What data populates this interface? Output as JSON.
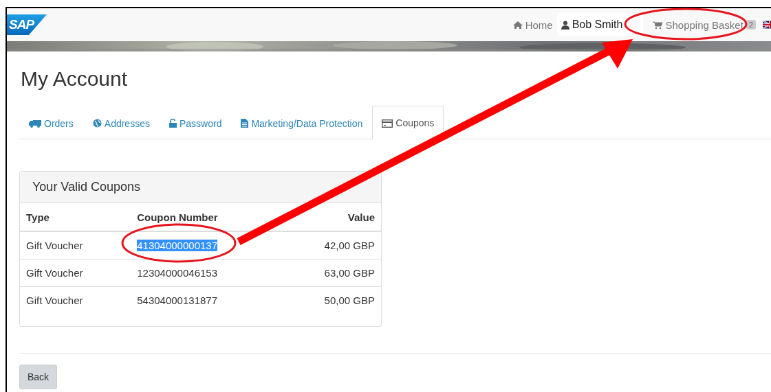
{
  "header": {
    "logo": "SAP",
    "nav": [
      {
        "kind": "home",
        "label": "Home"
      },
      {
        "kind": "user",
        "label": "Bob Smith"
      },
      {
        "kind": "cart",
        "label": "Shopping Basket",
        "badge": "2"
      },
      {
        "kind": "flag"
      }
    ]
  },
  "page": {
    "title": "My Account"
  },
  "tabs": [
    {
      "label": "Orders",
      "selected": false
    },
    {
      "label": "Addresses",
      "selected": false
    },
    {
      "label": "Password",
      "selected": false
    },
    {
      "label": "Marketing/Data Protection",
      "selected": false
    },
    {
      "label": "Coupons",
      "selected": true
    }
  ],
  "coupons": {
    "title": "Your Valid Coupons",
    "columns": [
      "Type",
      "Coupon Number",
      "Value"
    ],
    "rows": [
      {
        "type": "Gift Voucher",
        "number": "41304000000137",
        "value": "42,00 GBP",
        "highlighted": true
      },
      {
        "type": "Gift Voucher",
        "number": "12304000046153",
        "value": "63,00 GBP",
        "highlighted": false
      },
      {
        "type": "Gift Voucher",
        "number": "54304000131877",
        "value": "50,00 GBP",
        "highlighted": false
      }
    ]
  },
  "buttons": [
    {
      "label": "Back"
    }
  ],
  "annotations": [
    {
      "kind": "ellipse"
    },
    {
      "kind": "ellipse"
    },
    {
      "kind": "arrow"
    }
  ]
}
